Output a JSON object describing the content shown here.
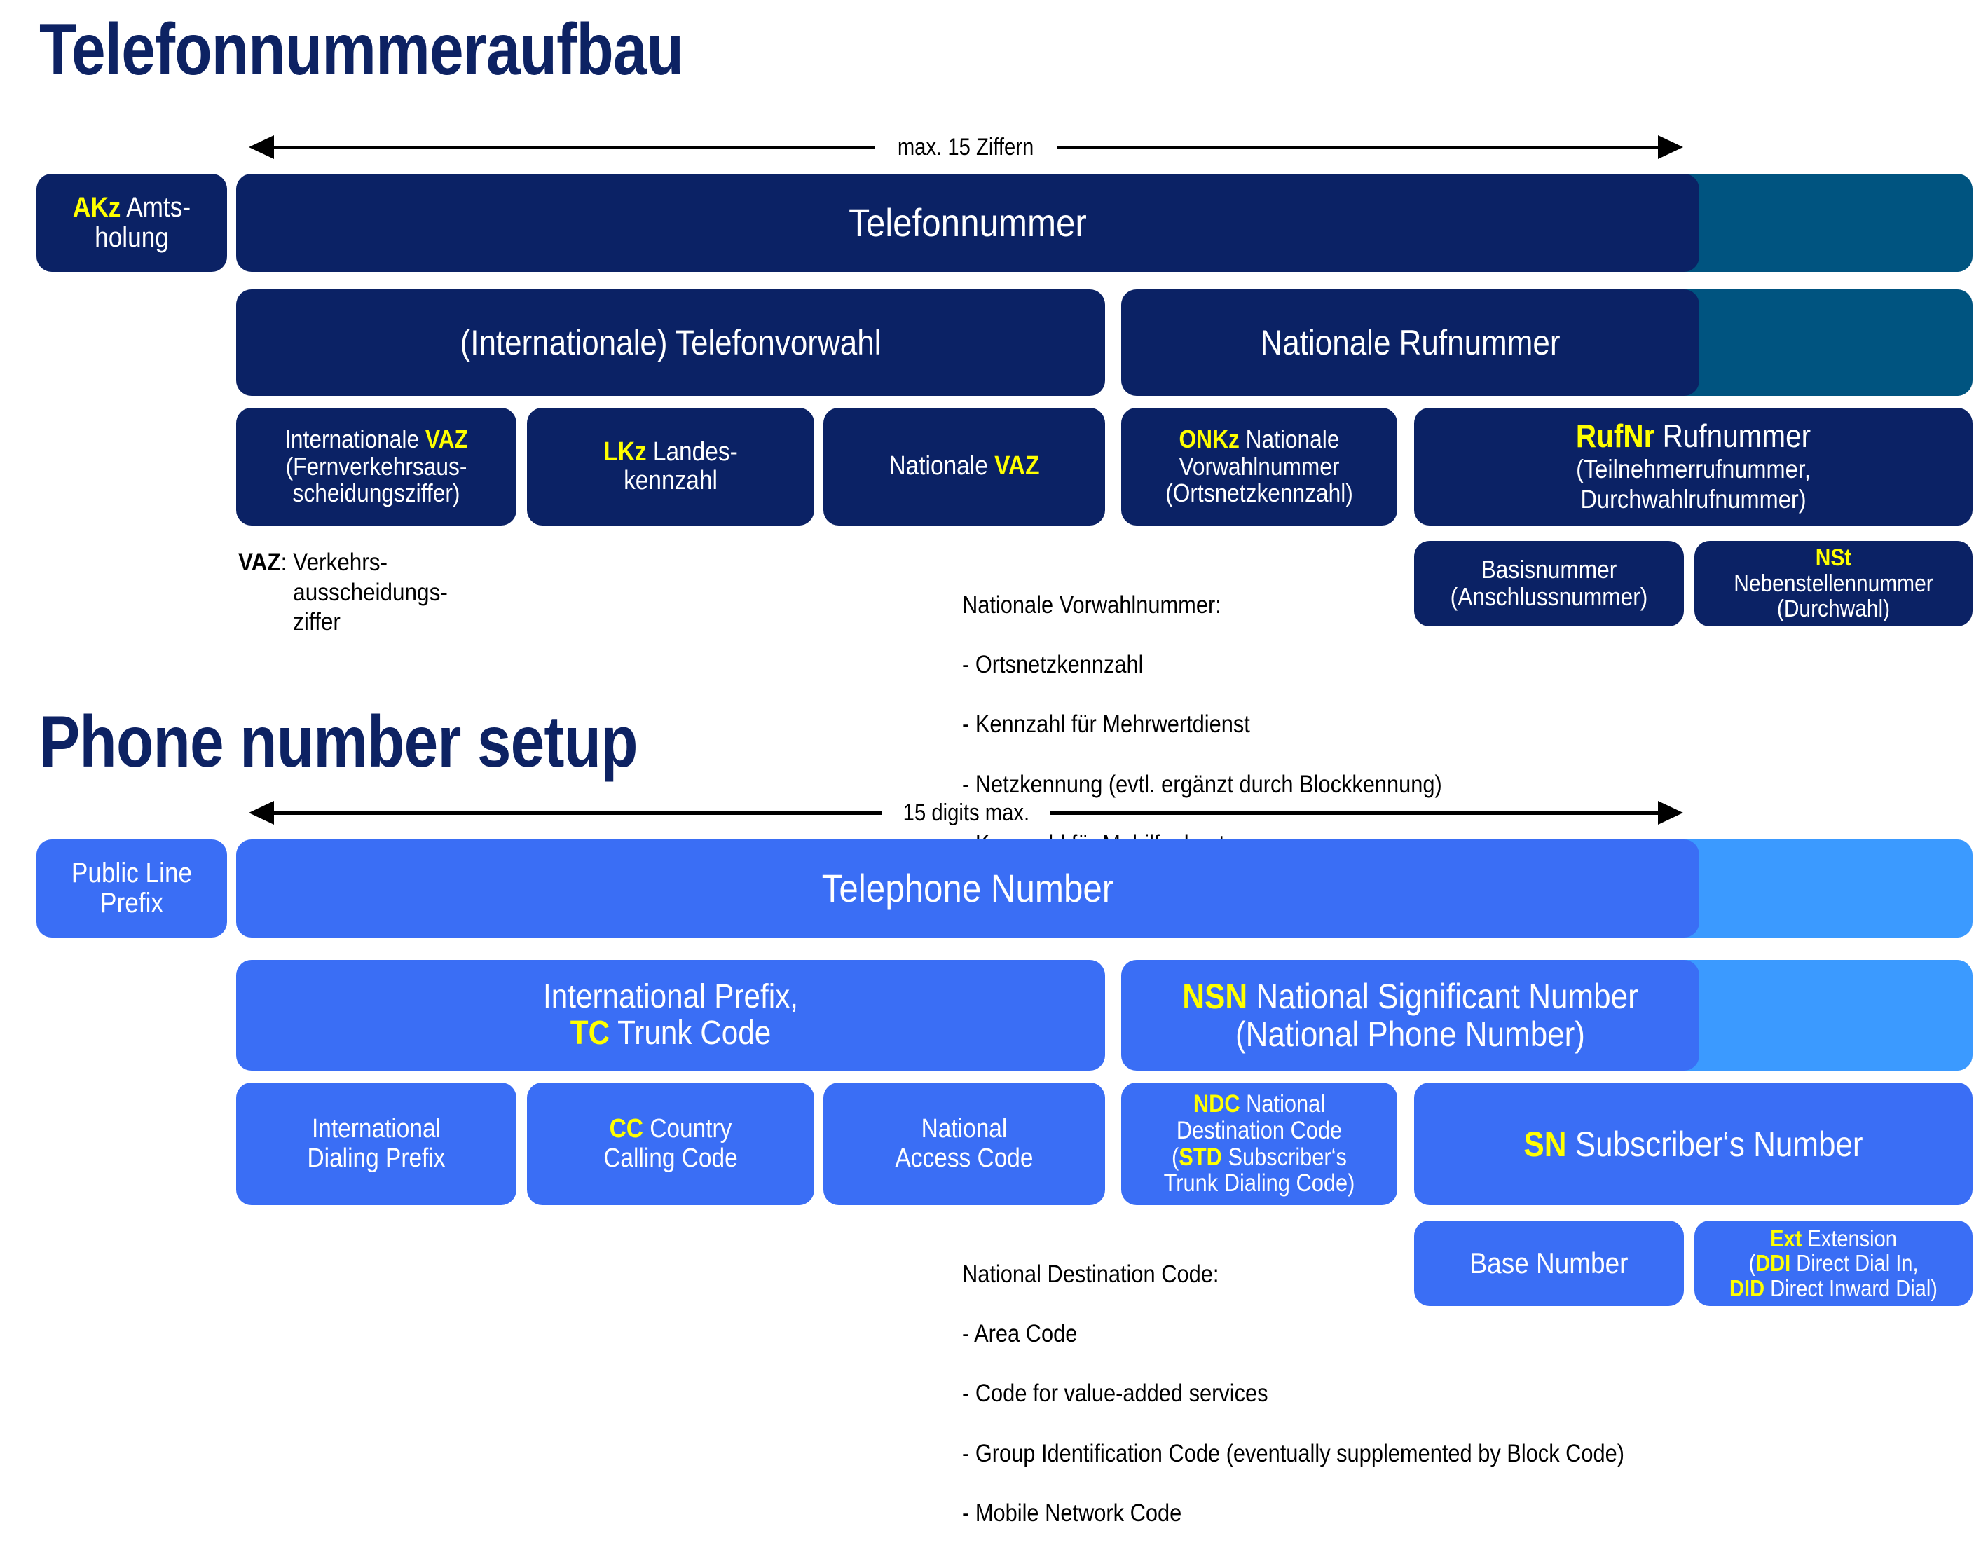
{
  "german": {
    "title": "Telefonnummeraufbau",
    "measure_label": "max. 15 Ziffern",
    "prefix_box": {
      "code": "AKz",
      "rest": " Amts-\nholung"
    },
    "level1": {
      "label": "Telefonnummer"
    },
    "level2": [
      {
        "label": "(Internationale) Telefonvorwahl"
      },
      {
        "label": "Nationale Rufnummer"
      }
    ],
    "level3": [
      {
        "code": "",
        "line1": "Internationale ",
        "codeinline": "VAZ",
        "line2": "(Fernverkehrsaus-\nscheidungsziffer)"
      },
      {
        "code": "LKz",
        "rest": " Landes-\nkennzahl"
      },
      {
        "code": "",
        "line1": "Nationale ",
        "codeinline": "VAZ",
        "line2": ""
      },
      {
        "code": "ONKz",
        "rest": " Nationale\nVorwahlnummer\n(Ortsnetzkennzahl)"
      },
      {
        "code": "RufNr",
        "rest": " Rufnummer",
        "sub": "(Teilnehmerrufnummer,\nDurchwahlrufnummer)"
      }
    ],
    "level4": [
      {
        "label": "Basisnummer\n(Anschlussnummer)"
      },
      {
        "code": "NSt",
        "rest": "\nNebenstellennummer\n(Durchwahl)"
      }
    ],
    "note_vaz": {
      "key": "VAZ",
      "sep": ": ",
      "text": "Verkehrs-\nausscheidungs-\nziffer"
    },
    "note_list": {
      "heading": "Nationale Vorwahlnummer:",
      "items": [
        "- Ortsnetzkennzahl",
        "- Kennzahl für Mehrwertdienst",
        "- Netzkennung (evtl. ergänzt durch Blockkennung)",
        "- Kennzahl für Mobilfunknetz"
      ]
    }
  },
  "english": {
    "title": "Phone number setup",
    "measure_label": "15 digits max.",
    "prefix_box": {
      "label": "Public Line\nPrefix"
    },
    "level1": {
      "label": "Telephone Number"
    },
    "level2": [
      {
        "line1": "International Prefix,",
        "code": "TC",
        "rest": " Trunk Code"
      },
      {
        "code": "NSN",
        "rest": " National Significant Number",
        "sub": "(National Phone Number)"
      }
    ],
    "level3": [
      {
        "label": "International\nDialing Prefix"
      },
      {
        "code": "CC",
        "rest": " Country\nCalling Code"
      },
      {
        "label": "National\nAccess Code"
      },
      {
        "code": "NDC",
        "rest": " National",
        "l2": "Destination Code",
        "l3open": "(",
        "code2": "STD",
        "l3rest": " Subscriber‘s",
        "l4": "Trunk Dialing Code)"
      },
      {
        "code": "SN",
        "rest": " Subscriber‘s Number"
      }
    ],
    "level4": [
      {
        "label": "Base Number"
      },
      {
        "code": "Ext",
        "rest": " Extension",
        "l2open": "(",
        "code2": "DDI",
        "l2rest": " Direct Dial In,",
        "code3": "DID",
        "l3rest": " Direct Inward Dial)"
      }
    ],
    "note_list": {
      "heading": "National Destination Code:",
      "items": [
        "- Area Code",
        "- Code for value-added services",
        "- Group Identification Code (eventually supplemented by Block Code)",
        "- Mobile Network Code"
      ]
    }
  },
  "colors": {
    "title": "#0d2263",
    "navy": "#0b2265",
    "navy_tail": "#005480",
    "blue": "#3a6ef5",
    "blue_tail": "#3b9aff",
    "accent": "#ffff00",
    "text_on_box": "#ffffff"
  }
}
